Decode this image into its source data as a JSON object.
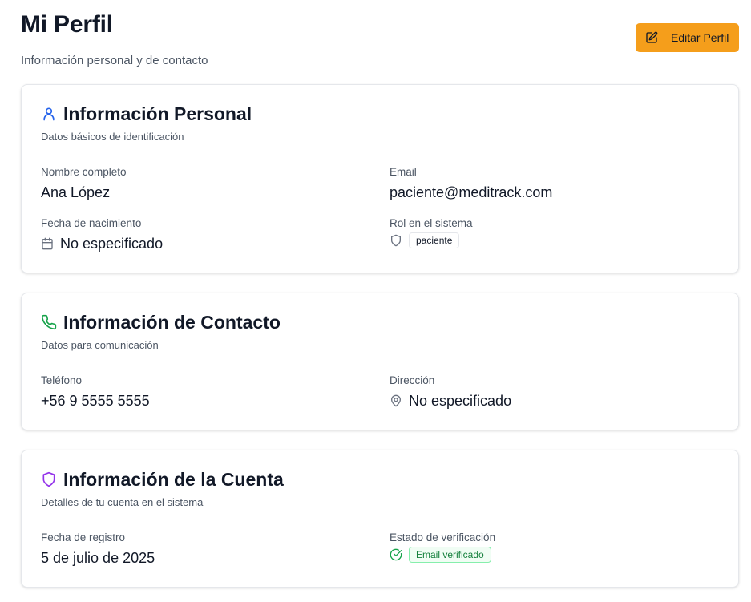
{
  "header": {
    "title": "Mi Perfil",
    "subtitle": "Información personal y de contacto",
    "edit_button": "Editar Perfil",
    "edit_icon": "edit-icon"
  },
  "colors": {
    "accent": "#f59e1b",
    "personal_icon": "#2563eb",
    "contact_icon": "#16a34a",
    "account_icon": "#9333ea",
    "verified": "#15803d"
  },
  "personal": {
    "icon": "user-icon",
    "title": "Información Personal",
    "description": "Datos básicos de identificación",
    "name_label": "Nombre completo",
    "name_value": "Ana López",
    "email_label": "Email",
    "email_value": "paciente@meditrack.com",
    "birth_label": "Fecha de nacimiento",
    "birth_icon": "calendar-icon",
    "birth_value": "No especificado",
    "role_label": "Rol en el sistema",
    "role_icon": "shield-icon",
    "role_value": "paciente"
  },
  "contact": {
    "icon": "phone-icon",
    "title": "Información de Contacto",
    "description": "Datos para comunicación",
    "phone_label": "Teléfono",
    "phone_value": "+56 9 5555 5555",
    "address_label": "Dirección",
    "address_icon": "map-pin-icon",
    "address_value": "No especificado"
  },
  "account": {
    "icon": "shield-icon",
    "title": "Información de la Cuenta",
    "description": "Detalles de tu cuenta en el sistema",
    "registered_label": "Fecha de registro",
    "registered_value": "5 de julio de 2025",
    "verification_label": "Estado de verificación",
    "verification_icon": "check-circle-icon",
    "verification_value": "Email verificado"
  }
}
